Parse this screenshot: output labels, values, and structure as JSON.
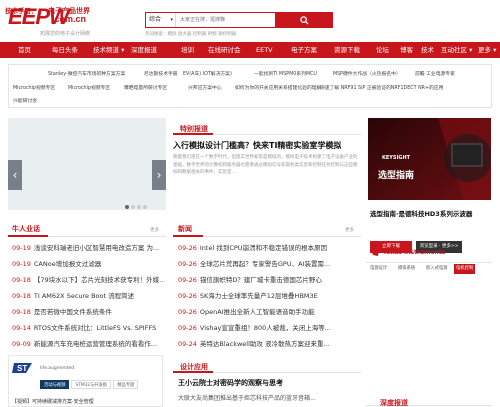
{
  "logo": {
    "mark": "EEPW",
    "cn": "电子产品世界",
    "domain": ".com.cn",
    "tagline": "拓展您的电子设计网络"
  },
  "search": {
    "category": "综合",
    "placeholder": "大家正在搜，逛搜赚",
    "hot_label": "热词搜索：",
    "hot_terms": "模拟 放大器 控制器 射频 微控制器"
  },
  "nav": [
    "首页",
    "每日头条",
    "技术频道",
    "深度报道",
    "培训",
    "在线研讨会",
    "EETV",
    "电子方案",
    "资源下载",
    "论坛",
    "博客",
    "技术",
    "互动社区",
    "更多"
  ],
  "tech": {
    "label": "技术手册：",
    "links": [
      "Stanley-微控汽车市场的种方案方案",
      "尼达斯技术手册",
      "EV(A车) IOT解决方案)",
      "一起找到TI MSPM0系列MCU",
      "MSP硬件大作战（火热报名中）",
      "前瞻·工业电源专家",
      "Microchip视频专区",
      "Microchip视频专区",
      "曝晒电量所研讨专区",
      "兴邦应方案中心",
      "如何为你的开关应用关系搭建化验的理解",
      "快速了解 NRF91 SiP 正被验证的NRF1DECT NR+的应用",
      "兴能研讨会"
    ]
  },
  "featured": {
    "section": "特别报道",
    "title": "入行模拟设计门槛高？快来TI精密实验室学模拟",
    "body": "随着我们现在一个数字时代，但现实世界却常是模拟的。模拟电子技术构建了电子设备产业的基础，数字世界的计算机和服务器也需要通过模拟信号获取各类信息和控制任务控制与这些模拟和数据相关的事件。实验室..."
  },
  "ad": {
    "brand": "KEYSIGHT",
    "title": "选型指南",
    "promo_title": "选型指南·是德科技HD3系列示波器",
    "btn_primary": "立即下载",
    "btn_secondary": "浏览型录 · 更多>>"
  },
  "industry": {
    "section": "牛人业话",
    "more": "更多",
    "items": [
      {
        "date": "09-19",
        "text": "浅谈安科瑞老旧小区智慧用电改造方案 为..."
      },
      {
        "date": "09-19",
        "text": "CANoe增加报文过滤器"
      },
      {
        "date": "09-18",
        "text": "【79块水以下】芯片光刻技术获专利！外媒..."
      },
      {
        "date": "09-18",
        "text": "TI AM62X Secure Boot 流程简述"
      },
      {
        "date": "09-18",
        "text": "是否若微中国文件系统条件"
      },
      {
        "date": "09-14",
        "text": "RTOS文件系统对比：LittleFS Vs. SPIFFS"
      },
      {
        "date": "09-09",
        "text": "新能源汽车充电桩运营管理系统的看看作..."
      }
    ]
  },
  "news": {
    "section": "新闻",
    "more": "更多",
    "items": [
      {
        "date": "09-26",
        "text": "Intel 找到CPU崩溃和不稳定错误的根本原因"
      },
      {
        "date": "09-26",
        "text": "全球芯片荒再起？专家警告GPU、AI装置需..."
      },
      {
        "date": "09-26",
        "text": "锚信旗帜特D？建厂城卡重击德国芯片野心"
      },
      {
        "date": "09-26",
        "text": "SK海力士全球率先量产12层堆叠HBM3E"
      },
      {
        "date": "09-26",
        "text": "OpenAI推出全新人工智能语音助手功能"
      },
      {
        "date": "09-26",
        "text": "Vishay宣宣重组！800人被裁，关闭上海等..."
      },
      {
        "date": "09-24",
        "text": "英特达Blackwell助攻 液冷散热方案迎来重..."
      }
    ]
  },
  "ti": {
    "brand": "Texas Instruments",
    "tabs": [
      "电源设计",
      "模拟系统",
      "嵌入式电源",
      "电机控制"
    ]
  },
  "st": {
    "brand": "life.augmented",
    "tabs": [
      "活动与视频",
      "STM32与开发板",
      "精品专题"
    ],
    "news": "【视频】可持续碳减排方案·安全管理"
  },
  "design": {
    "section": "设计应用",
    "title": "王小云院士对密码学的观察与思考",
    "body": "大联大友尚集团推出基于炬芯科技产品的蓝牙音箱..."
  },
  "deep": {
    "section": "深度报道"
  },
  "colors": {
    "brand": "#c8161d"
  }
}
